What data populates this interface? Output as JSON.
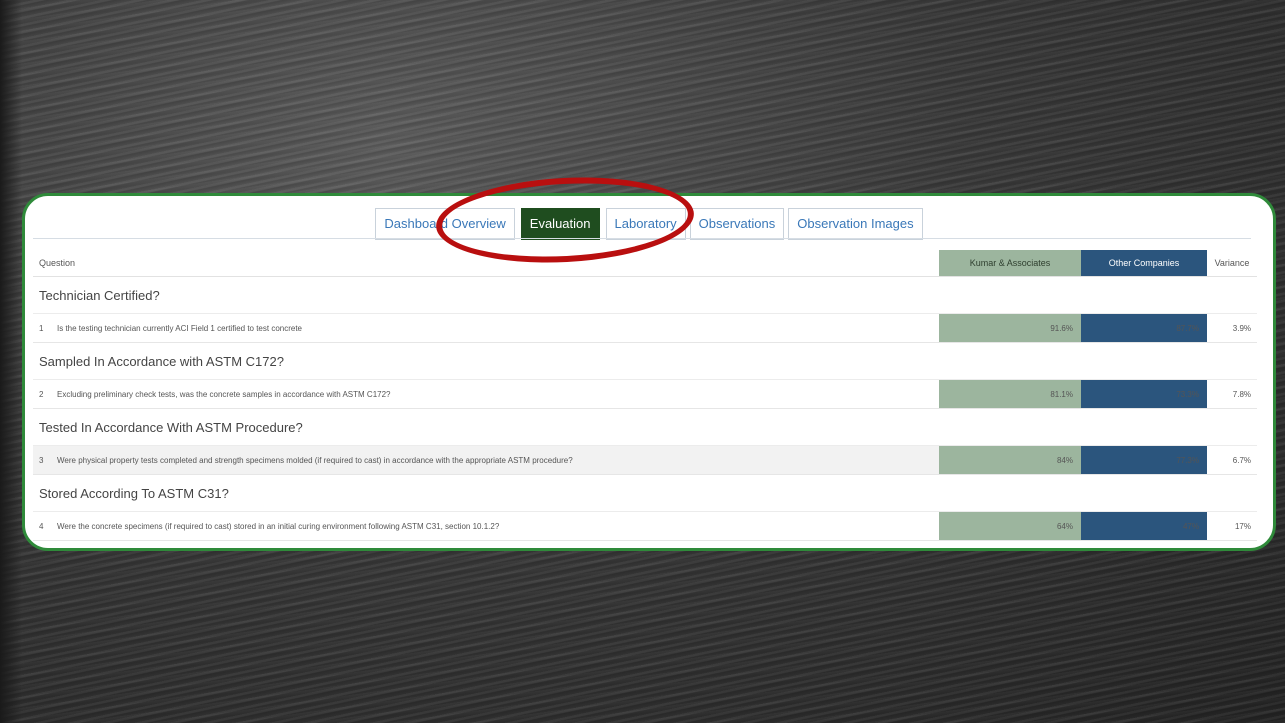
{
  "tabs": [
    {
      "label": "Dashboard Overview",
      "active": false
    },
    {
      "label": "Evaluation",
      "active": true
    },
    {
      "label": "Laboratory",
      "active": false
    },
    {
      "label": "Observations",
      "active": false
    },
    {
      "label": "Observation Images",
      "active": false
    }
  ],
  "table": {
    "headers": {
      "question": "Question",
      "kumar": "Kumar & Associates",
      "other": "Other Companies",
      "variance": "Variance"
    },
    "groups": [
      {
        "title": "Technician Certified?",
        "question": {
          "num": "1",
          "text": "Is the testing technician currently ACI Field 1 certified to test concrete",
          "kumar": "91.6%",
          "other": "87.7%",
          "variance": "3.9%"
        }
      },
      {
        "title": "Sampled In Accordance with ASTM C172?",
        "question": {
          "num": "2",
          "text": "Excluding preliminary check tests, was the concrete samples in accordance with ASTM C172?",
          "kumar": "81.1%",
          "other": "73.3%",
          "variance": "7.8%"
        }
      },
      {
        "title": "Tested In Accordance With ASTM Procedure?",
        "question": {
          "num": "3",
          "text": "Were physical property tests completed and strength specimens molded (if required to cast) in accordance with the appropriate ASTM procedure?",
          "kumar": "84%",
          "other": "77.3%",
          "variance": "6.7%"
        }
      },
      {
        "title": "Stored According To ASTM C31?",
        "question": {
          "num": "4",
          "text": "Were the concrete specimens (if required to cast) stored in an initial curing environment following ASTM C31, section 10.1.2?",
          "kumar": "64%",
          "other": "47%",
          "variance": "17%"
        }
      }
    ]
  },
  "colors": {
    "panel_border": "#2f8a3a",
    "active_tab": "#1f4d1f",
    "kumar_column": "#9cb59e",
    "other_column": "#2b557d",
    "highlight_ring": "#b90f0f"
  }
}
